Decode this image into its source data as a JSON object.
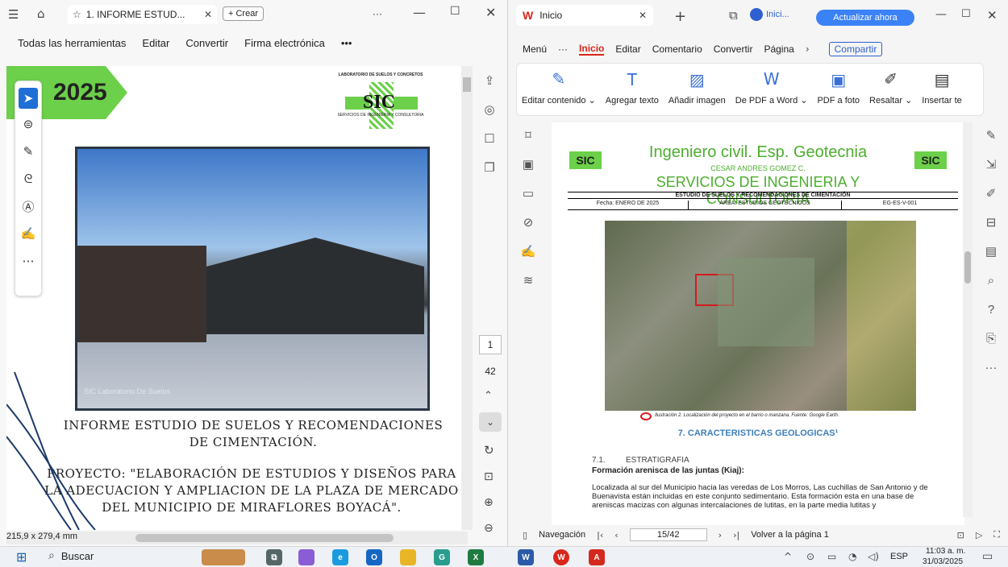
{
  "left_window": {
    "tab_title": "1. INFORME ESTUD...",
    "new_button": "+ Crear",
    "more": "···",
    "menu": [
      "Todas las herramientas",
      "Editar",
      "Convertir",
      "Firma electrónica",
      "•••"
    ],
    "page": {
      "year": "2025",
      "logo_top": "LABORATORIO DE SUELOS Y CONCRETOS",
      "logo_mark": "SIC",
      "logo_sub": "SERVICIOS DE INGENIERIA Y CONSULTORIA",
      "photo_caption": "SIC Laboratorio De Suelos",
      "title": "INFORME ESTUDIO DE SUELOS Y RECOMENDACIONES DE CIMENTACIÓN.",
      "project": "PROYECTO: \"ELABORACIÓN DE ESTUDIOS Y DISEÑOS PARA LA ADECUACION Y AMPLIACION DE LA PLAZA DE MERCADO DEL MUNICIPIO DE MIRAFLORES BOYACÁ\"."
    },
    "page_current": "1",
    "page_total": "42",
    "page_size": "215,9 x 279,4 mm"
  },
  "right_window": {
    "tab_title": "Inicio",
    "user": "Inici...",
    "update_button": "Actualizar ahora",
    "menu": {
      "menu": "Menú",
      "inicio": "Inicio",
      "editar": "Editar",
      "comentario": "Comentario",
      "convertir": "Convertir",
      "pagina": "Página",
      "compartir": "Compartir"
    },
    "ribbon": [
      "Editar contenido ⌄",
      "Agregar texto",
      "Añadir imagen",
      "De PDF a Word ⌄",
      "PDF a foto",
      "Resaltar ⌄",
      "Insertar te"
    ],
    "doc": {
      "header_title": "Ingeniero civil. Esp. Geotecnia",
      "header_name": "CESAR ANDRES GOMEZ C.",
      "header_company": "SERVICIOS DE INGENIERIA Y CONSULTORIA",
      "study": "ESTUDIO DE SUELOS Y RECOMENDACIONES DE CIMENTACIÓN",
      "fecha": "Fecha: ENERO DE 2025",
      "area": "ÁREA: ESTUDIOS GEOTÉCNICOS",
      "code": "EG-ES-V-001",
      "map_caption": "Ilustración 2. Localización del proyecto en el barrio o manzana. Fuente: Google Earth.",
      "section": "7.  CARACTERISTICAS GEOLOGICAS¹",
      "sub_num": "7.1.",
      "sub_title": "ESTRATIGRAFIA",
      "bold_line": "Formación arenisca de las juntas (Kiaj):",
      "para": "Localizada al sur del Municipio hacia las veredas de Los Morros, Las cuchillas de San Antonio y de Buenavista están incluidas en este conjunto sedimentario. Esta formación esta en una base de areniscas macizas con algunas intercalaciones de lutitas, en la parte media lutitas y"
    },
    "statusbar": {
      "nav": "Navegación",
      "page": "15/42",
      "back": "Volver a la página 1"
    }
  },
  "taskbar": {
    "search": "Buscar",
    "lang": "ESP",
    "time": "11:03 a. m.",
    "date": "31/03/2025"
  },
  "colors": {
    "accent": "#6cd04a",
    "wps_red": "#d9261c",
    "blue": "#3a6fd8"
  }
}
